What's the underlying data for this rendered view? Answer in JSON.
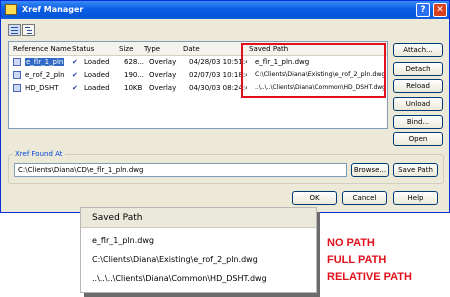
{
  "window": {
    "title": "Xref Manager",
    "help_glyph": "?",
    "close_glyph": "✕"
  },
  "table": {
    "headers": [
      "Reference Name",
      "Status",
      "Size",
      "Type",
      "Date",
      "Saved Path"
    ],
    "rows": [
      {
        "name": "e_flr_1_pln",
        "status": "Loaded",
        "size": "628...",
        "type": "Overlay",
        "date": "04/28/03 10:51:4...",
        "saved_path": "e_flr_1_pln.dwg",
        "selected": true
      },
      {
        "name": "e_rof_2_pln",
        "status": "Loaded",
        "size": "190...",
        "type": "Overlay",
        "date": "02/07/03 10:18:4...",
        "saved_path": "C:\\Clients\\Diana\\Existing\\e_rof_2_pln.dwg",
        "selected": false
      },
      {
        "name": "HD_DSHT",
        "status": "Loaded",
        "size": "10KB",
        "type": "Overlay",
        "date": "04/30/03 08:24:4...",
        "saved_path": "..\\..\\..\\Clients\\Diana\\Common\\HD_DSHT.dwg",
        "selected": false
      }
    ]
  },
  "side_buttons": [
    "Attach...",
    "Detach",
    "Reload",
    "Unload",
    "Bind...",
    "Open"
  ],
  "found_at": {
    "label": "Xref Found At",
    "path": "C:\\Clients\\Diana\\CD\\e_flr_1_pln.dwg",
    "browse_label": "Browse...",
    "save_path_label": "Save Path"
  },
  "footer_buttons": {
    "ok": "OK",
    "cancel": "Cancel",
    "help": "Help"
  },
  "callout": {
    "header": "Saved Path",
    "rows": [
      "e_flr_1_pln.dwg",
      "C:\\Clients\\Diana\\Existing\\e_rof_2_pln.dwg",
      "..\\..\\..\\Clients\\Diana\\Common\\HD_DSHT.dwg"
    ],
    "labels": [
      "NO PATH",
      "FULL PATH",
      "RELATIVE PATH"
    ]
  },
  "colors": {
    "title_bar": "#0a5ee6",
    "highlight_red": "#e0101c",
    "selection": "#316ac5",
    "dialog_bg": "#ece9d8"
  },
  "icons": [
    "xref-manager-app-icon",
    "list-view-icon",
    "tree-view-icon",
    "drawing-file-icon",
    "loaded-check-icon"
  ]
}
